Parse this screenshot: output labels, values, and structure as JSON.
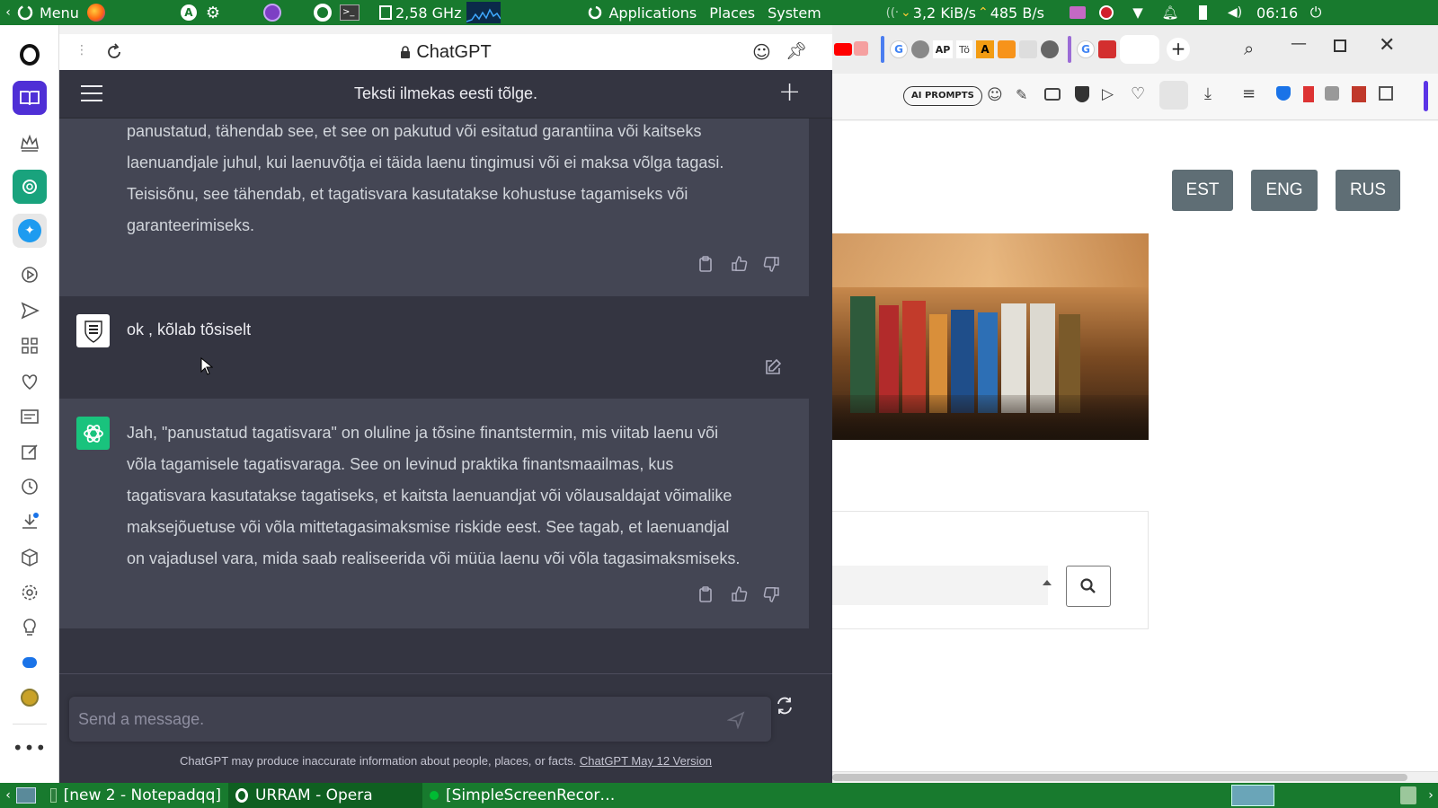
{
  "system_panel": {
    "menu_label": "Menu",
    "cpu_freq": "2,58 GHz",
    "applications_label": "Applications",
    "places_label": "Places",
    "system_label": "System",
    "download_speed": "3,2 KiB/s",
    "upload_speed": "485 B/s",
    "clock": "06:16"
  },
  "taskbar": {
    "tasks": [
      {
        "label": "[new 2 - Notepadqq]"
      },
      {
        "label": "URRAM - Opera"
      },
      {
        "label": "[SimpleScreenRecor…"
      }
    ]
  },
  "chat": {
    "window_title": "ChatGPT",
    "conversation_title": "Teksti ilmekas eesti tõlge.",
    "messages": [
      {
        "role": "assistant",
        "lines": [
          "panustatud, tähendab see, et see on pakutud või esitatud garantiina või kaitseks",
          "laenuandjale juhul, kui laenuvõtja ei täida laenu tingimusi või ei maksa võlga tagasi.",
          "Teisisõnu, see tähendab, et tagatisvara kasutatakse kohustuse tagamiseks või",
          "garanteerimiseks."
        ]
      },
      {
        "role": "user",
        "text": "ok , kõlab tõsiselt"
      },
      {
        "role": "assistant",
        "lines": [
          "Jah, \"panustatud tagatisvara\" on oluline ja tõsine finantstermin, mis viitab laenu või",
          "võla tagamisele tagatisvaraga. See on levinud praktika finantsmaailmas, kus",
          "tagatisvara kasutatakse tagatiseks, et kaitsta laenuandjat või võlausaldajat võimalike",
          "maksejõuetuse või võla mittetagasimaksmise riskide eest. See tagab, et laenuandjal",
          "on vajadusel vara, mida saab realiseerida või müüa laenu või võla tagasimaksmiseks."
        ]
      }
    ],
    "composer_placeholder": "Send a message.",
    "disclaimer_text": "ChatGPT may produce inaccurate information about people, places, or facts.",
    "disclaimer_link": "ChatGPT May 12 Version"
  },
  "browser": {
    "toolbar": {
      "ai_prompts_label": "AI PROMPTS"
    },
    "page": {
      "language_buttons": [
        "EST",
        "ENG",
        "RUS"
      ]
    }
  },
  "colors": {
    "panel_green": "#187a2e",
    "chat_bg": "#343541",
    "chat_user_bg": "#343541",
    "chat_assistant_bg": "#444654",
    "gpt_green": "#19c37d",
    "lang_button": "#5f6e75"
  }
}
